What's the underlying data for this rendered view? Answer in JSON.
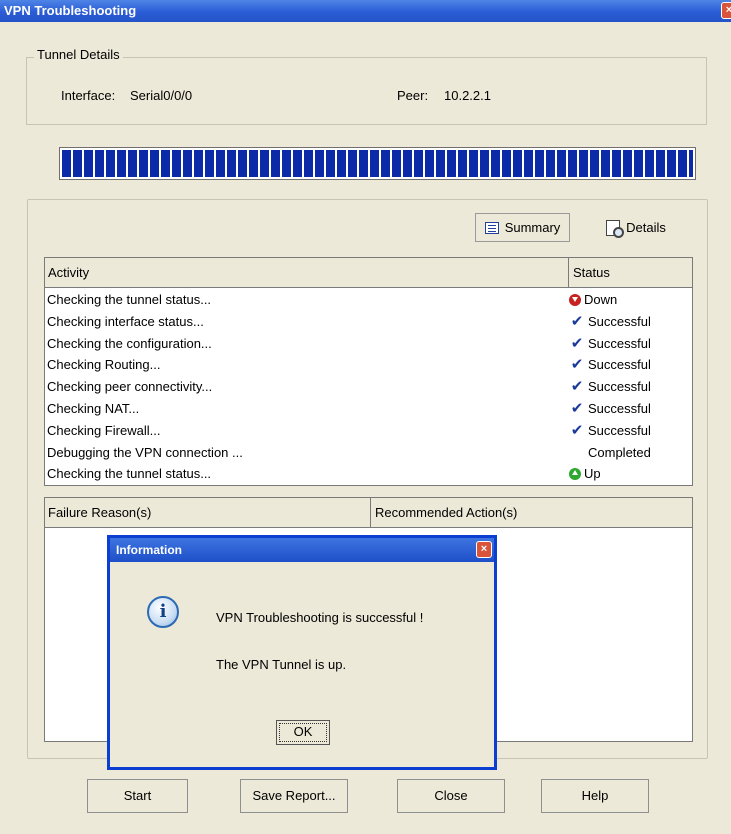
{
  "window": {
    "title": "VPN Troubleshooting",
    "close_glyph": "×"
  },
  "tunnel": {
    "legend": "Tunnel Details",
    "interface_label": "Interface:",
    "interface_value": "Serial0/0/0",
    "peer_label": "Peer:",
    "peer_value": "10.2.2.1"
  },
  "progress": {
    "fraction": 1.0
  },
  "view_buttons": {
    "summary": "Summary",
    "details": "Details"
  },
  "activity_table": {
    "headers": {
      "activity": "Activity",
      "status": "Status"
    },
    "rows": [
      {
        "activity": "Checking the tunnel status...",
        "status": "Down",
        "icon": "down"
      },
      {
        "activity": "Checking interface status...",
        "status": "Successful",
        "icon": "check"
      },
      {
        "activity": "Checking the configuration...",
        "status": "Successful",
        "icon": "check"
      },
      {
        "activity": "Checking Routing...",
        "status": "Successful",
        "icon": "check"
      },
      {
        "activity": "Checking peer connectivity...",
        "status": "Successful",
        "icon": "check"
      },
      {
        "activity": "Checking NAT...",
        "status": "Successful",
        "icon": "check"
      },
      {
        "activity": "Checking Firewall...",
        "status": "Successful",
        "icon": "check"
      },
      {
        "activity": "Debugging the VPN connection ...",
        "status": "Completed",
        "icon": "none"
      },
      {
        "activity": "Checking the tunnel status...",
        "status": "Up",
        "icon": "up"
      }
    ]
  },
  "failure_table": {
    "headers": {
      "reason": "Failure Reason(s)",
      "action": "Recommended Action(s)"
    }
  },
  "buttons": {
    "start": "Start",
    "save_report": "Save Report...",
    "close": "Close",
    "help": "Help"
  },
  "dialog": {
    "title": "Information",
    "close_glyph": "×",
    "icon_glyph": "i",
    "message1": "VPN Troubleshooting is successful !",
    "message2": "The VPN Tunnel is up.",
    "ok": "OK"
  },
  "colors": {
    "titlebar": "#2a5cd6",
    "progress": "#0a2aa8",
    "down": "#c62222",
    "up": "#2ea82e",
    "check": "#1a3a9a",
    "window_bg": "#ece9d8"
  }
}
